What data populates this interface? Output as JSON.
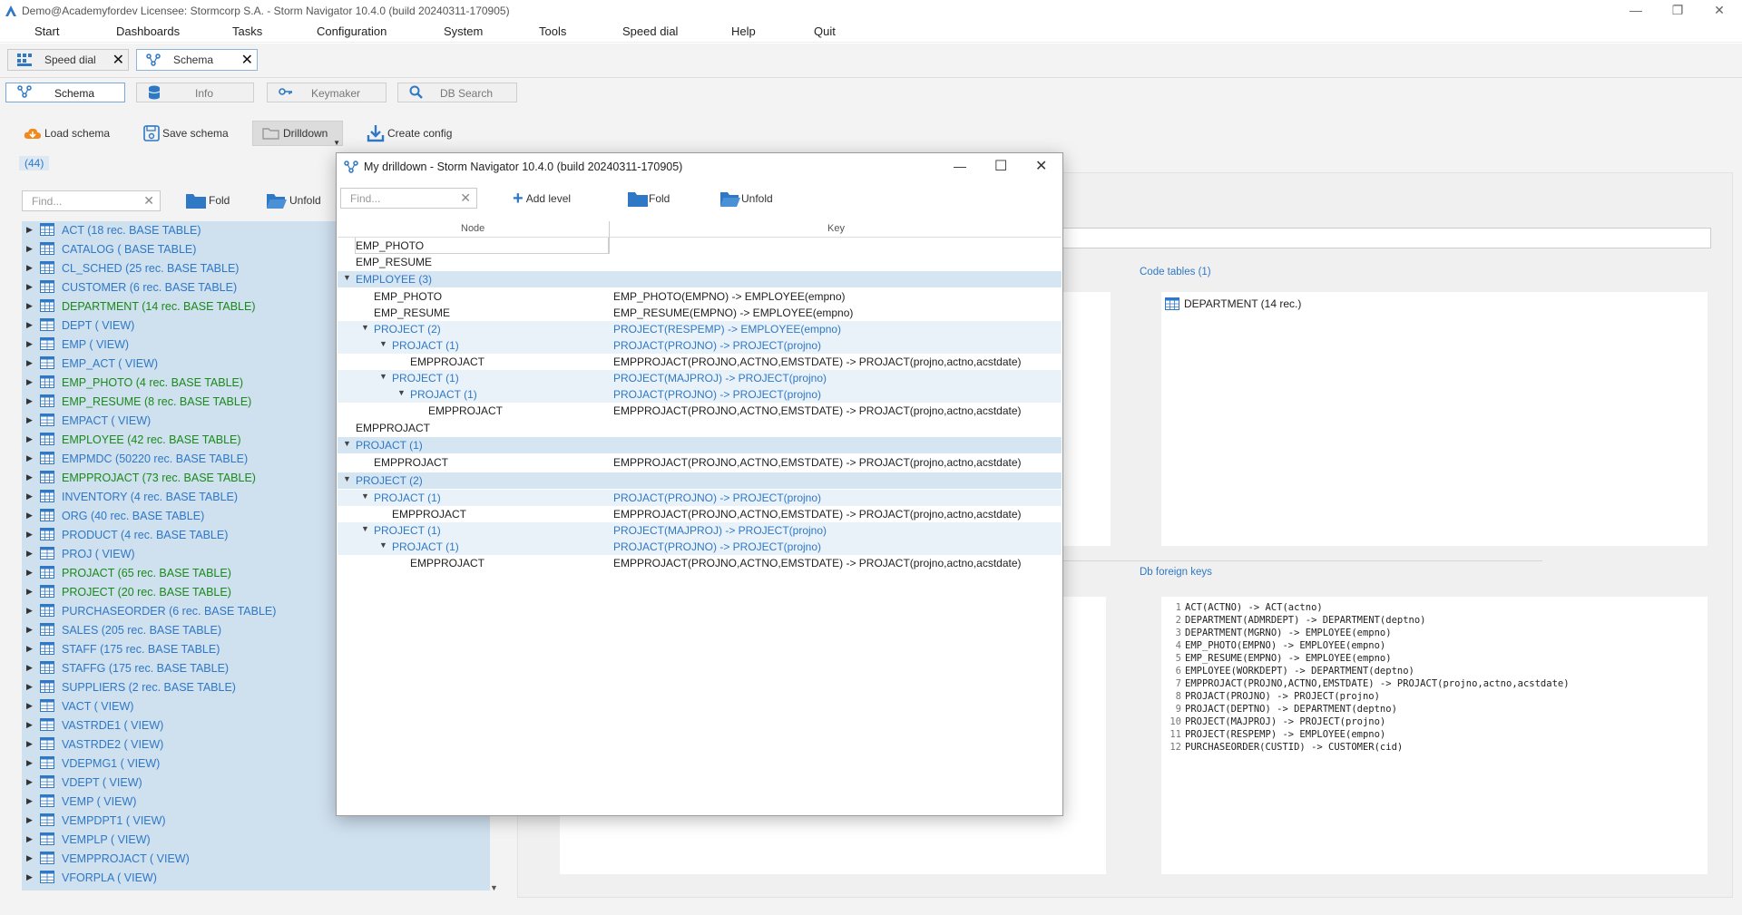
{
  "window": {
    "title": "Demo@Academyfordev    Licensee: Stormcorp S.A. -  Storm Navigator 10.4.0 (build 20240311-170905)"
  },
  "menu": [
    "Start",
    "Dashboards",
    "Tasks",
    "Configuration",
    "System",
    "Tools",
    "Speed dial",
    "Help",
    "Quit"
  ],
  "doc_tabs": [
    {
      "label": "Speed dial",
      "icon": "speed-dial-icon"
    },
    {
      "label": "Schema",
      "icon": "schema-icon",
      "active": true
    }
  ],
  "sub_tabs": [
    {
      "label": "Schema",
      "icon": "schema-icon",
      "active": true
    },
    {
      "label": "Info",
      "icon": "database-icon"
    },
    {
      "label": "Keymaker",
      "icon": "key-icon"
    },
    {
      "label": "DB Search",
      "icon": "search-icon"
    }
  ],
  "toolbar": {
    "load_schema": "Load schema",
    "save_schema": "Save schema",
    "drilldown": "Drilldown",
    "create_config": "Create config"
  },
  "left": {
    "count": "(44)",
    "find_placeholder": "Find...",
    "fold": "Fold",
    "unfold": "Unfold",
    "tables": [
      {
        "label": "ACT (18 rec. BASE TABLE)",
        "kind": "table"
      },
      {
        "label": "CATALOG ( BASE TABLE)",
        "kind": "table"
      },
      {
        "label": "CL_SCHED (25 rec. BASE TABLE)",
        "kind": "table"
      },
      {
        "label": "CUSTOMER (6 rec. BASE TABLE)",
        "kind": "table"
      },
      {
        "label": "DEPARTMENT (14 rec. BASE TABLE)",
        "kind": "table",
        "green": true
      },
      {
        "label": "DEPT ( VIEW)",
        "kind": "view"
      },
      {
        "label": "EMP ( VIEW)",
        "kind": "view"
      },
      {
        "label": "EMP_ACT ( VIEW)",
        "kind": "view"
      },
      {
        "label": "EMP_PHOTO (4 rec. BASE TABLE)",
        "kind": "table",
        "green": true
      },
      {
        "label": "EMP_RESUME (8 rec. BASE TABLE)",
        "kind": "table",
        "green": true
      },
      {
        "label": "EMPACT ( VIEW)",
        "kind": "view"
      },
      {
        "label": "EMPLOYEE (42 rec. BASE TABLE)",
        "kind": "table",
        "green": true
      },
      {
        "label": "EMPMDC (50220 rec. BASE TABLE)",
        "kind": "table"
      },
      {
        "label": "EMPPROJACT (73 rec. BASE TABLE)",
        "kind": "table",
        "green": true
      },
      {
        "label": "INVENTORY (4 rec. BASE TABLE)",
        "kind": "table"
      },
      {
        "label": "ORG (40 rec. BASE TABLE)",
        "kind": "table"
      },
      {
        "label": "PRODUCT (4 rec. BASE TABLE)",
        "kind": "table"
      },
      {
        "label": "PROJ ( VIEW)",
        "kind": "view"
      },
      {
        "label": "PROJACT (65 rec. BASE TABLE)",
        "kind": "table",
        "green": true
      },
      {
        "label": "PROJECT (20 rec. BASE TABLE)",
        "kind": "table",
        "green": true
      },
      {
        "label": "PURCHASEORDER (6 rec. BASE TABLE)",
        "kind": "table"
      },
      {
        "label": "SALES (205 rec. BASE TABLE)",
        "kind": "table"
      },
      {
        "label": "STAFF (175 rec. BASE TABLE)",
        "kind": "table"
      },
      {
        "label": "STAFFG (175 rec. BASE TABLE)",
        "kind": "table"
      },
      {
        "label": "SUPPLIERS (2 rec. BASE TABLE)",
        "kind": "table"
      },
      {
        "label": "VACT ( VIEW)",
        "kind": "view"
      },
      {
        "label": "VASTRDE1 ( VIEW)",
        "kind": "view"
      },
      {
        "label": "VASTRDE2 ( VIEW)",
        "kind": "view"
      },
      {
        "label": "VDEPMG1 ( VIEW)",
        "kind": "view"
      },
      {
        "label": "VDEPT ( VIEW)",
        "kind": "view"
      },
      {
        "label": "VEMP ( VIEW)",
        "kind": "view"
      },
      {
        "label": "VEMPDPT1 ( VIEW)",
        "kind": "view"
      },
      {
        "label": "VEMPLP ( VIEW)",
        "kind": "view"
      },
      {
        "label": "VEMPPROJACT ( VIEW)",
        "kind": "view"
      },
      {
        "label": "VFORPLA ( VIEW)",
        "kind": "view"
      }
    ]
  },
  "right": {
    "code_tables_label": "Code tables (1)",
    "code_tables": [
      "DEPARTMENT (14 rec.)"
    ],
    "fk_label": "Db foreign keys",
    "foreign_keys": [
      "ACT(ACTNO) -> ACT(actno)",
      "DEPARTMENT(ADMRDEPT) -> DEPARTMENT(deptno)",
      "DEPARTMENT(MGRNO) -> EMPLOYEE(empno)",
      "EMP_PHOTO(EMPNO) -> EMPLOYEE(empno)",
      "EMP_RESUME(EMPNO) -> EMPLOYEE(empno)",
      "EMPLOYEE(WORKDEPT) -> DEPARTMENT(deptno)",
      "EMPPROJACT(PROJNO,ACTNO,EMSTDATE) -> PROJACT(projno,actno,acstdate)",
      "PROJACT(PROJNO) -> PROJECT(projno)",
      "PROJACT(DEPTNO) -> DEPARTMENT(deptno)",
      "PROJECT(MAJPROJ) -> PROJECT(projno)",
      "PROJECT(RESPEMP) -> EMPLOYEE(empno)",
      "PURCHASEORDER(CUSTID) -> CUSTOMER(cid)"
    ]
  },
  "popup": {
    "title": "My drilldown -  Storm Navigator 10.4.0 (build 20240311-170905)",
    "find_placeholder": "Find...",
    "add_level": "Add level",
    "fold": "Fold",
    "unfold": "Unfold",
    "col_node": "Node",
    "col_key": "Key",
    "rows": [
      {
        "node": "EMP_PHOTO",
        "key": "",
        "level": 0,
        "expander": false,
        "style": "plain"
      },
      {
        "node": "EMP_RESUME",
        "key": "",
        "level": 0,
        "expander": false,
        "style": "plain"
      },
      {
        "node": "EMPLOYEE (3)",
        "key": "",
        "level": 0,
        "expander": true,
        "style": "group"
      },
      {
        "node": "EMP_PHOTO",
        "key": "EMP_PHOTO(EMPNO) -> EMPLOYEE(empno)",
        "level": 1,
        "expander": false,
        "style": "plain"
      },
      {
        "node": "EMP_RESUME",
        "key": "EMP_RESUME(EMPNO) -> EMPLOYEE(empno)",
        "level": 1,
        "expander": false,
        "style": "plain"
      },
      {
        "node": "PROJECT (2)",
        "key": "PROJECT(RESPEMP) -> EMPLOYEE(empno)",
        "level": 1,
        "expander": true,
        "style": "sub"
      },
      {
        "node": "PROJACT (1)",
        "key": "PROJACT(PROJNO) -> PROJECT(projno)",
        "level": 2,
        "expander": true,
        "style": "sub"
      },
      {
        "node": "EMPPROJACT",
        "key": "EMPPROJACT(PROJNO,ACTNO,EMSTDATE) -> PROJACT(projno,actno,acstdate)",
        "level": 3,
        "expander": false,
        "style": "plain"
      },
      {
        "node": "PROJECT (1)",
        "key": "PROJECT(MAJPROJ) -> PROJECT(projno)",
        "level": 2,
        "expander": true,
        "style": "sub"
      },
      {
        "node": "PROJACT (1)",
        "key": "PROJACT(PROJNO) -> PROJECT(projno)",
        "level": 3,
        "expander": true,
        "style": "sub"
      },
      {
        "node": "EMPPROJACT",
        "key": "EMPPROJACT(PROJNO,ACTNO,EMSTDATE) -> PROJACT(projno,actno,acstdate)",
        "level": 4,
        "expander": false,
        "style": "plain"
      },
      {
        "node": "EMPPROJACT",
        "key": "",
        "level": 0,
        "expander": false,
        "style": "plain"
      },
      {
        "node": "PROJACT (1)",
        "key": "",
        "level": 0,
        "expander": true,
        "style": "group"
      },
      {
        "node": "EMPPROJACT",
        "key": "EMPPROJACT(PROJNO,ACTNO,EMSTDATE) -> PROJACT(projno,actno,acstdate)",
        "level": 1,
        "expander": false,
        "style": "plain"
      },
      {
        "node": "PROJECT (2)",
        "key": "",
        "level": 0,
        "expander": true,
        "style": "group"
      },
      {
        "node": "PROJACT (1)",
        "key": "PROJACT(PROJNO) -> PROJECT(projno)",
        "level": 1,
        "expander": true,
        "style": "sub"
      },
      {
        "node": "EMPPROJACT",
        "key": "EMPPROJACT(PROJNO,ACTNO,EMSTDATE) -> PROJACT(projno,actno,acstdate)",
        "level": 2,
        "expander": false,
        "style": "plain"
      },
      {
        "node": "PROJECT (1)",
        "key": "PROJECT(MAJPROJ) -> PROJECT(projno)",
        "level": 1,
        "expander": true,
        "style": "sub"
      },
      {
        "node": "PROJACT (1)",
        "key": "PROJACT(PROJNO) -> PROJECT(projno)",
        "level": 2,
        "expander": true,
        "style": "sub"
      },
      {
        "node": "EMPPROJACT",
        "key": "EMPPROJACT(PROJNO,ACTNO,EMSTDATE) -> PROJACT(projno,actno,acstdate)",
        "level": 3,
        "expander": false,
        "style": "plain"
      }
    ]
  },
  "colors": {
    "accent": "#2f78c5",
    "green_text": "#1a8a1a",
    "selection": "#cfe0ef"
  }
}
